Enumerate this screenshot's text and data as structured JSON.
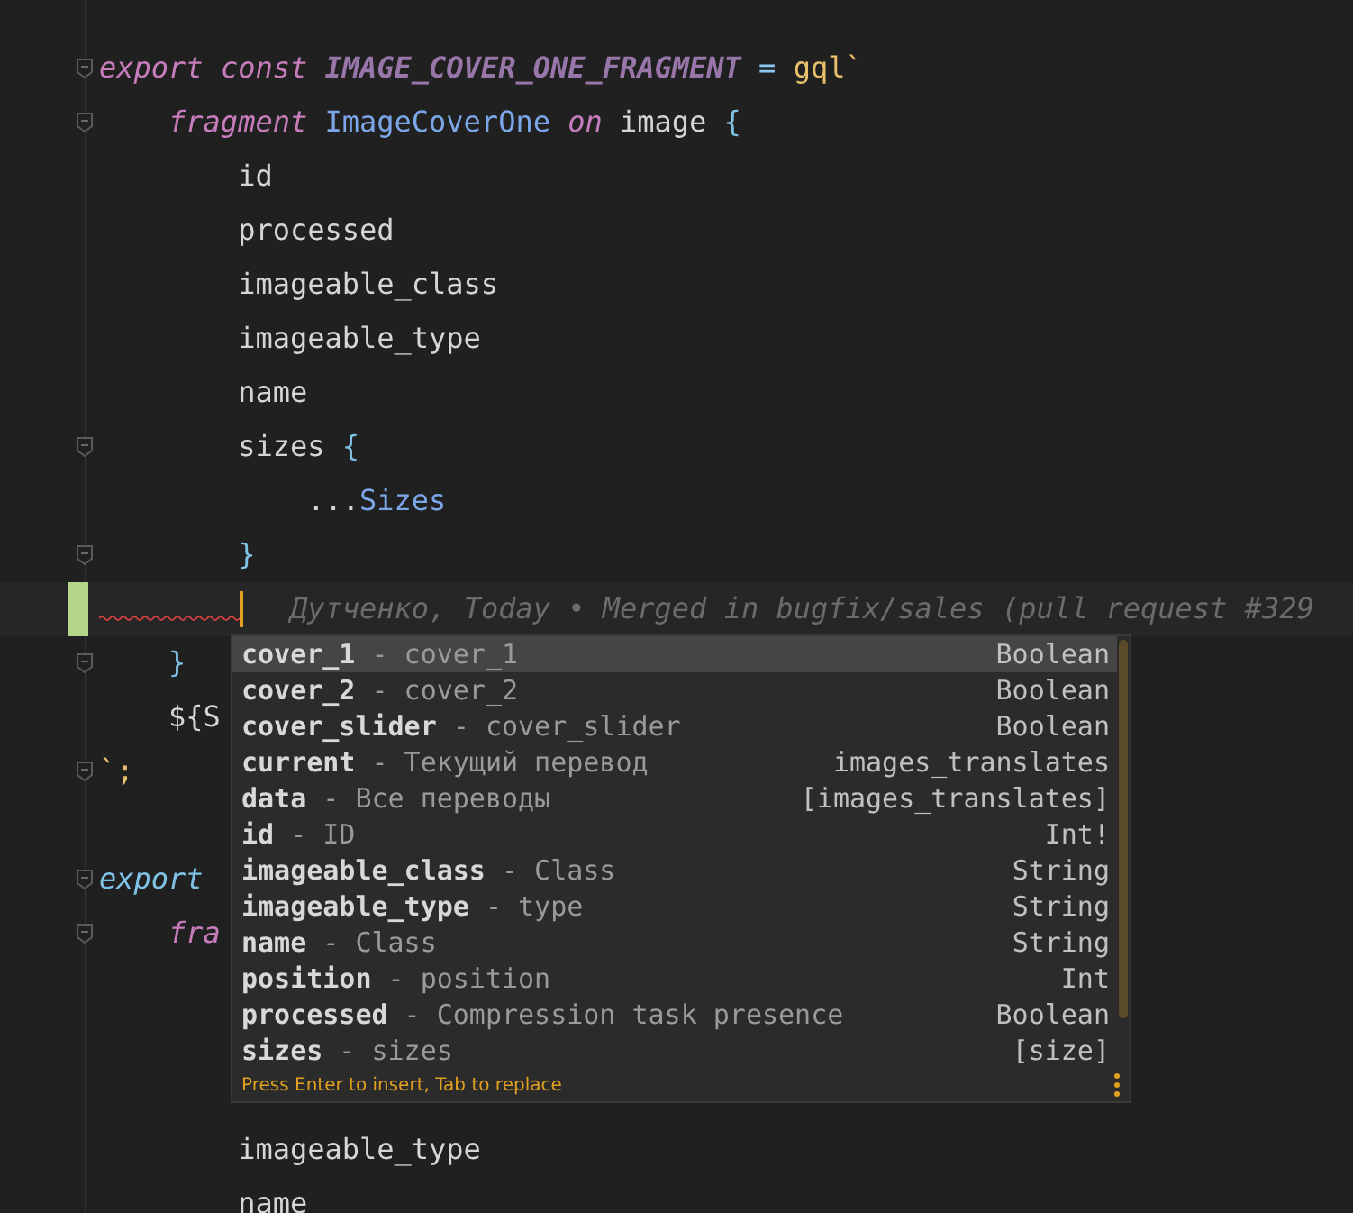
{
  "editor": {
    "blocks": [
      {
        "lines": [
          {
            "fold": true,
            "tokens": [
              {
                "text": "export ",
                "kind": "keyword"
              },
              {
                "text": "const ",
                "kind": "keyword"
              },
              {
                "text": "IMAGE_COVER_ONE_FRAGMENT",
                "kind": "constant"
              },
              {
                "text": " = ",
                "kind": "operator"
              },
              {
                "text": "gql`",
                "kind": "function"
              }
            ]
          },
          {
            "fold": true,
            "tokens": [
              {
                "text": "    fragment ",
                "kind": "keyword"
              },
              {
                "text": "ImageCoverOne ",
                "kind": "type"
              },
              {
                "text": "on ",
                "kind": "keyword"
              },
              {
                "text": "image ",
                "kind": "plain"
              },
              {
                "text": "{",
                "kind": "brace"
              }
            ]
          },
          {
            "tokens": [
              {
                "text": "        id",
                "kind": "plain"
              }
            ]
          },
          {
            "tokens": [
              {
                "text": "        processed",
                "kind": "plain"
              }
            ]
          },
          {
            "tokens": [
              {
                "text": "        imageable_class",
                "kind": "plain"
              }
            ]
          },
          {
            "tokens": [
              {
                "text": "        imageable_type",
                "kind": "plain"
              }
            ]
          },
          {
            "tokens": [
              {
                "text": "        name",
                "kind": "plain"
              }
            ]
          },
          {
            "fold": true,
            "tokens": [
              {
                "text": "        sizes ",
                "kind": "plain"
              },
              {
                "text": "{",
                "kind": "brace"
              }
            ]
          },
          {
            "tokens": [
              {
                "text": "            ...",
                "kind": "plain"
              },
              {
                "text": "Sizes",
                "kind": "type"
              }
            ]
          },
          {
            "fold": true,
            "tokens": [
              {
                "text": "        }",
                "kind": "brace"
              }
            ]
          },
          {
            "current": true,
            "changed": true,
            "squiggle": true,
            "blame": "Дутченко, Today • Merged in bugfix/sales (pull request #329"
          },
          {
            "fold": true,
            "tokens": [
              {
                "text": "    }",
                "kind": "brace"
              }
            ]
          },
          {
            "tokens": [
              {
                "text": "    ${S",
                "kind": "plain"
              }
            ]
          },
          {
            "fold": true,
            "tokens": [
              {
                "text": "`;",
                "kind": "function"
              }
            ]
          }
        ]
      },
      {
        "lines": [
          {
            "fold": true,
            "tokens": [
              {
                "text": "export",
                "kind": "keyword2"
              }
            ]
          },
          {
            "fold": true,
            "tokens": [
              {
                "text": "    fra",
                "kind": "keyword"
              }
            ]
          }
        ]
      },
      {
        "lines": [
          {
            "tokens": [
              {
                "text": "        imageable_type",
                "kind": "plain"
              }
            ]
          },
          {
            "tokens": [
              {
                "text": "        name",
                "kind": "plain"
              }
            ]
          }
        ]
      }
    ]
  },
  "completion": {
    "items": [
      {
        "name": "cover_1",
        "detail": "cover_1",
        "type": "Boolean",
        "selected": true
      },
      {
        "name": "cover_2",
        "detail": "cover_2",
        "type": "Boolean",
        "selected": false
      },
      {
        "name": "cover_slider",
        "detail": "cover_slider",
        "type": "Boolean",
        "selected": false
      },
      {
        "name": "current",
        "detail": "Текущий перевод",
        "type": "images_translates",
        "selected": false
      },
      {
        "name": "data",
        "detail": "Все переводы",
        "type": "[images_translates]",
        "selected": false
      },
      {
        "name": "id",
        "detail": "ID",
        "type": "Int!",
        "selected": false
      },
      {
        "name": "imageable_class",
        "detail": "Class",
        "type": "String",
        "selected": false
      },
      {
        "name": "imageable_type",
        "detail": "type",
        "type": "String",
        "selected": false
      },
      {
        "name": "name",
        "detail": "Class",
        "type": "String",
        "selected": false
      },
      {
        "name": "position",
        "detail": "position",
        "type": "Int",
        "selected": false
      },
      {
        "name": "processed",
        "detail": "Compression task presence",
        "type": "Boolean",
        "selected": false
      },
      {
        "name": "sizes",
        "detail": "sizes",
        "type": "[size]",
        "selected": false
      }
    ],
    "separator": "-",
    "hint": "Press Enter to insert, Tab to replace"
  }
}
